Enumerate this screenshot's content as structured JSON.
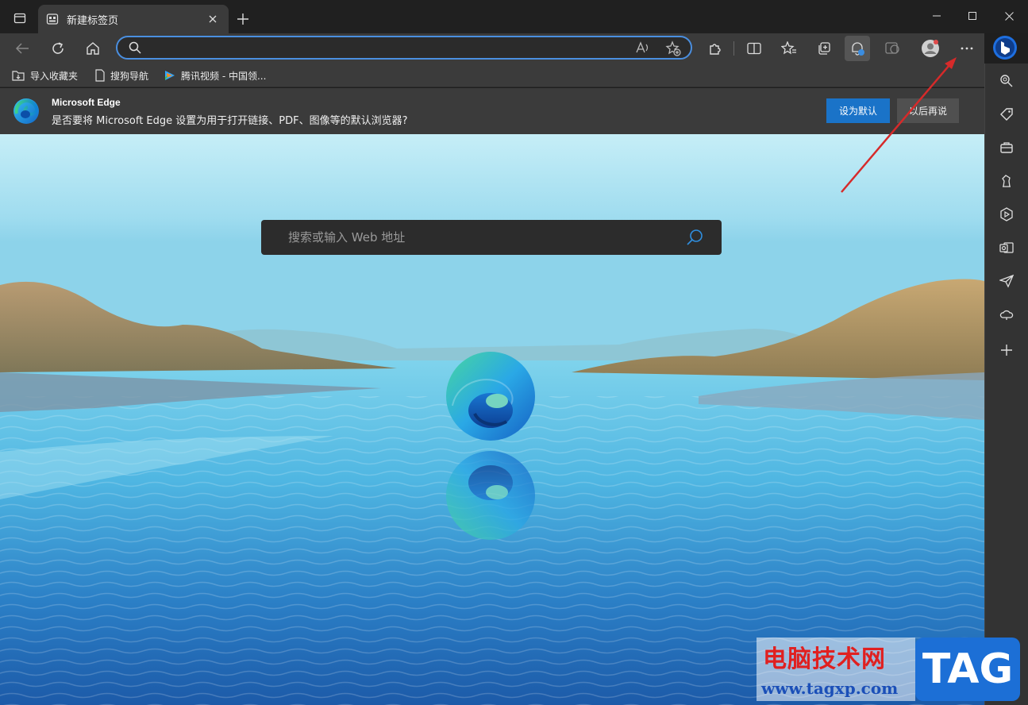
{
  "browser": {
    "tab": {
      "title": "新建标签页"
    },
    "toolbar": {
      "address_value": "",
      "address_placeholder": ""
    },
    "favorites": [
      {
        "label": "导入收藏夹",
        "icon": "import-favorites-icon"
      },
      {
        "label": "搜狗导航",
        "icon": "page-icon"
      },
      {
        "label": "腾讯视频 - 中国领...",
        "icon": "tencent-video-icon"
      }
    ]
  },
  "infobar": {
    "title": "Microsoft Edge",
    "message": "是否要将 Microsoft Edge 设置为用于打开链接、PDF、图像等的默认浏览器?",
    "primary_button": "设为默认",
    "secondary_button": "以后再说"
  },
  "newtab": {
    "search_placeholder": "搜索或输入 Web 地址"
  },
  "watermark": {
    "site_name": "电脑技术网",
    "url": "www.tagxp.com",
    "tag": "TAG"
  },
  "colors": {
    "accent": "#1a73c8",
    "address_border": "#4a8fe0",
    "annotation_arrow": "#d62a2a",
    "watermark_red": "#e02020",
    "watermark_blue": "#1c6fd6"
  }
}
